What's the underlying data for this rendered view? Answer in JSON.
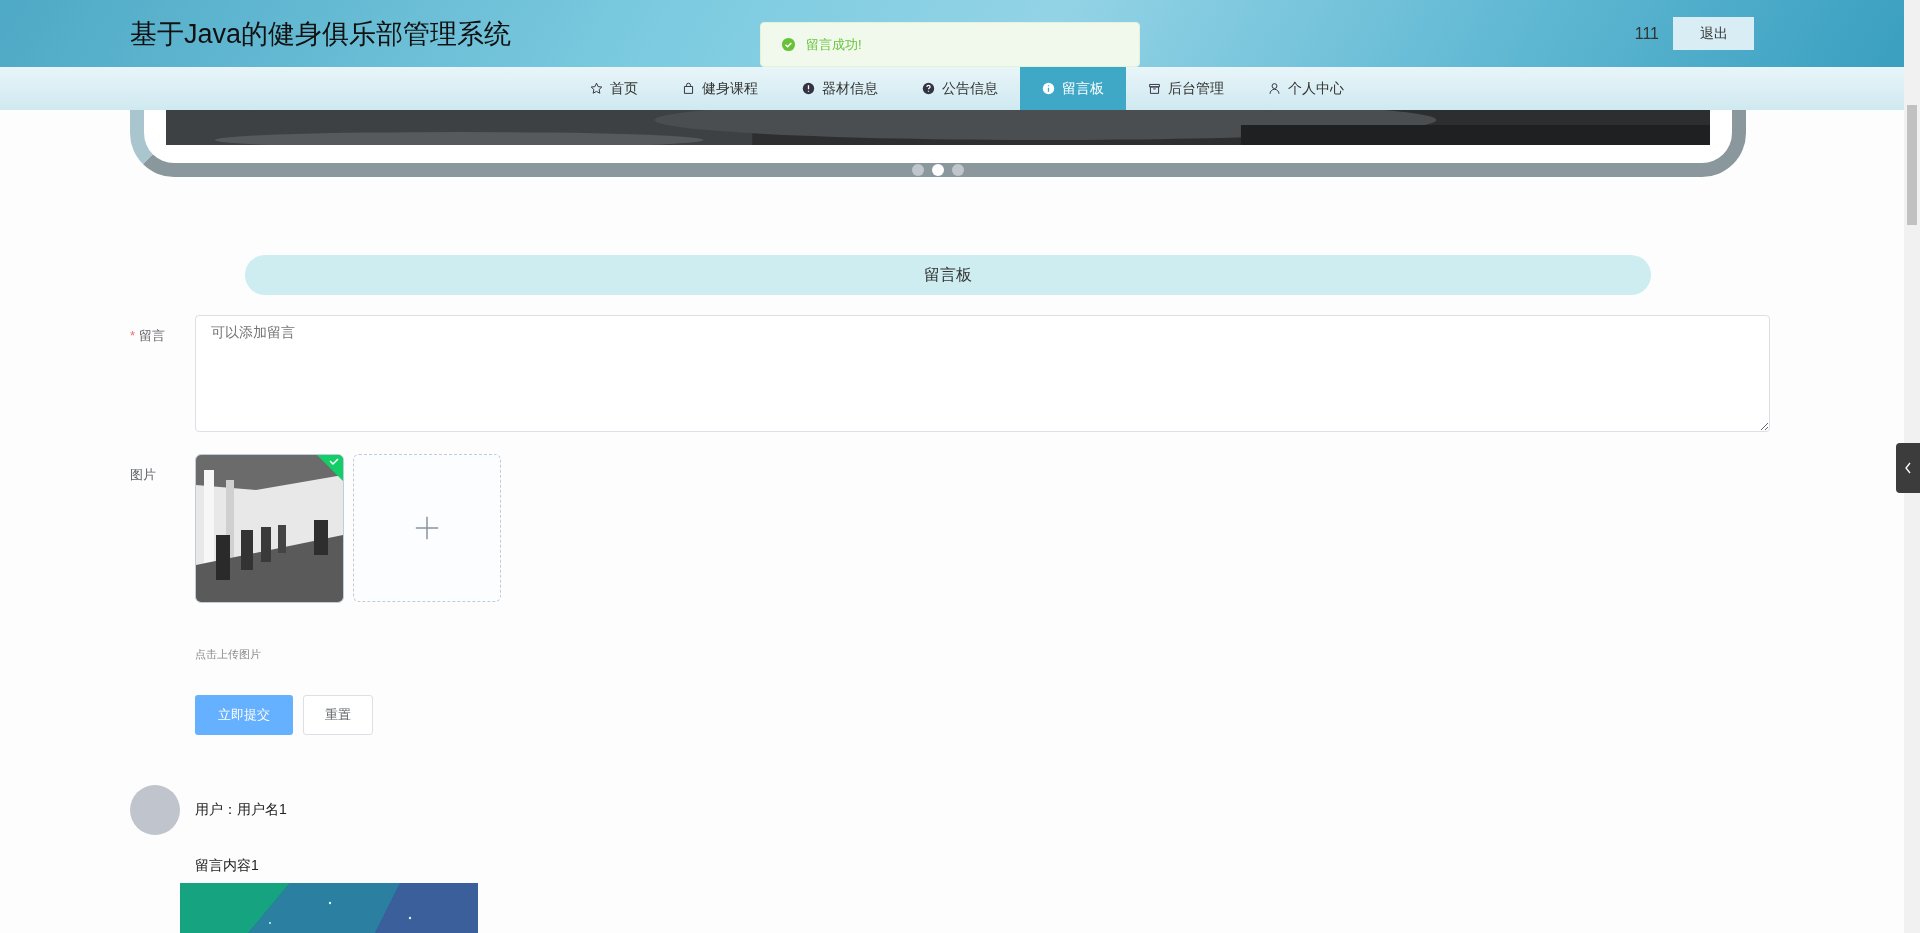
{
  "header": {
    "title": "基于Java的健身俱乐部管理系统",
    "user": "111",
    "logout": "退出"
  },
  "toast": {
    "message": "留言成功!"
  },
  "nav": [
    {
      "label": "首页",
      "selected": false
    },
    {
      "label": "健身课程",
      "selected": false
    },
    {
      "label": "器材信息",
      "selected": false
    },
    {
      "label": "公告信息",
      "selected": false
    },
    {
      "label": "留言板",
      "selected": true
    },
    {
      "label": "后台管理",
      "selected": false
    },
    {
      "label": "个人中心",
      "selected": false
    }
  ],
  "carousel": {
    "dots": [
      {
        "selected": false
      },
      {
        "selected": true
      },
      {
        "selected": false
      }
    ]
  },
  "section_title": "留言板",
  "form": {
    "message_label": "留言",
    "required_mark": "*",
    "message_placeholder": "可以添加留言",
    "image_label": "图片",
    "upload_done": true,
    "upload_hint": "点击上传图片",
    "submit": "立即提交",
    "reset": "重置"
  },
  "comments": [
    {
      "user": "用户：用户名1",
      "content": "留言内容1"
    }
  ]
}
